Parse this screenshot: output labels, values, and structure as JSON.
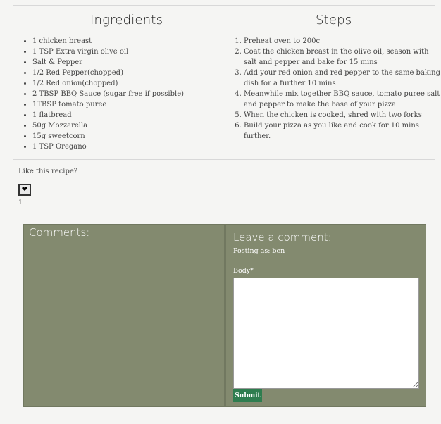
{
  "ingredients": {
    "title": "Ingredients",
    "items": [
      "1 chicken breast",
      "1 TSP Extra virgin olive oil",
      "Salt & Pepper",
      "1/2 Red Pepper(chopped)",
      "1/2 Red onion(chopped)",
      "2 TBSP BBQ Sauce (sugar free if possible)",
      "1TBSP tomato puree",
      "1 flatbread",
      "50g Mozzarella",
      "15g sweetcorn",
      "1 TSP Oregano"
    ]
  },
  "steps": {
    "title": "Steps",
    "items": [
      "Preheat oven to 200c",
      "Coat the chicken breast in the olive oil, season with salt and pepper and bake for 15 mins",
      "Add your red onion and red pepper to the same baking dish for a further 10 mins",
      "Meanwhile mix together BBQ sauce, tomato puree salt and pepper to make the base of your pizza",
      "When the chicken is cooked, shred with two forks",
      "Build your pizza as you like and cook for 10 mins further."
    ]
  },
  "like": {
    "question": "Like this recipe?",
    "icon": "heart-icon",
    "glyph": "❤",
    "count": "1"
  },
  "comments": {
    "title": "Comments:"
  },
  "leave_comment": {
    "title": "Leave a comment:",
    "posting_as": "Posting as: ben",
    "body_label": "Body*",
    "body_value": "",
    "submit_label": "Submit"
  },
  "colors": {
    "panel_bg": "#838a6f",
    "submit_bg": "#2e7d4f",
    "page_bg": "#f5f5f3"
  }
}
